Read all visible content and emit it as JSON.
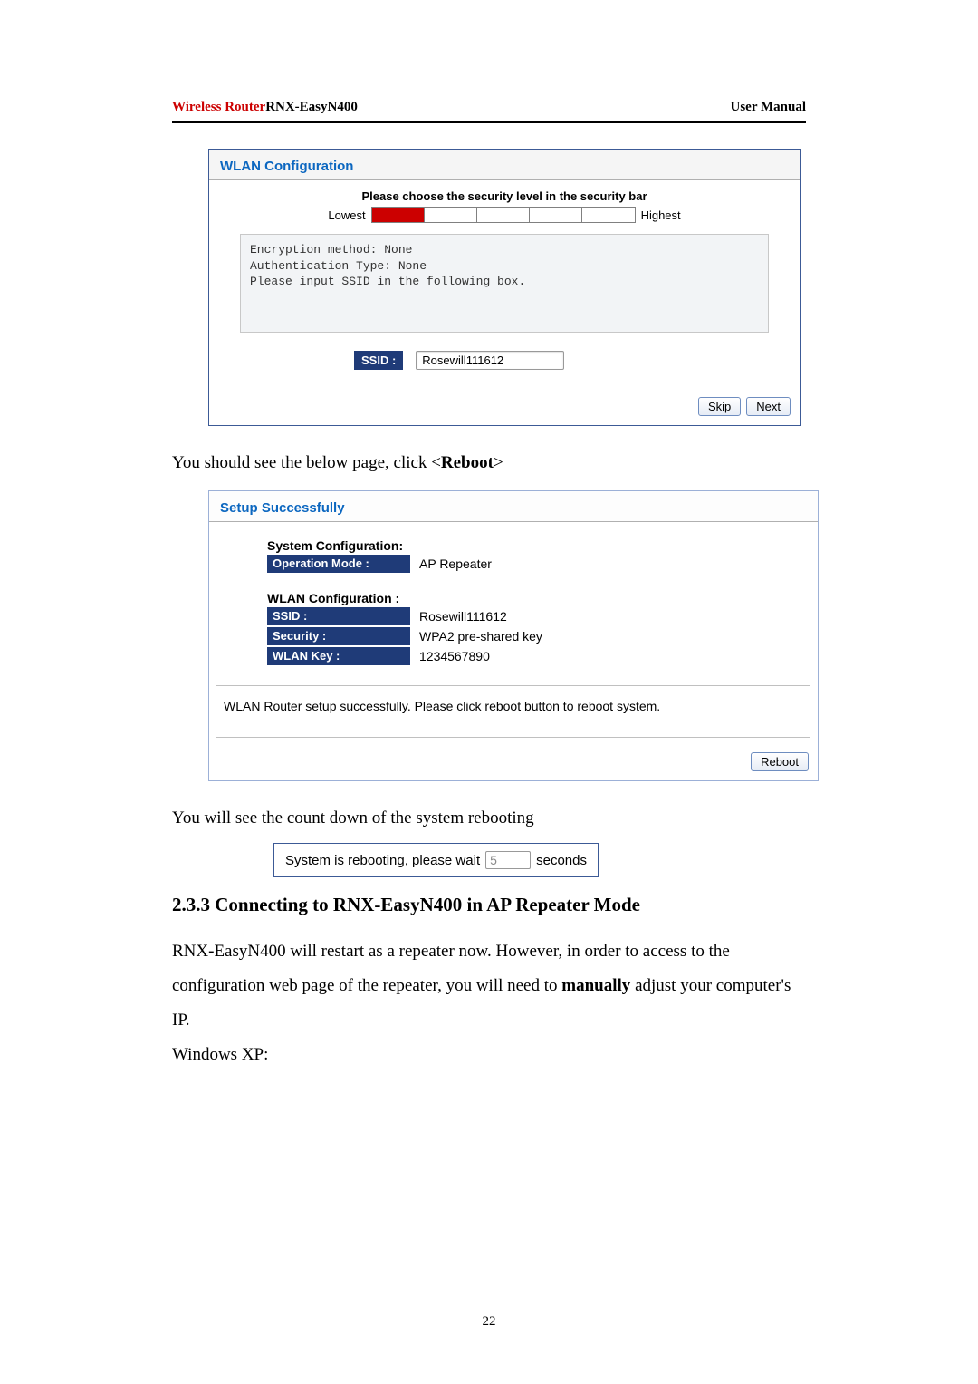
{
  "header": {
    "brand": "Wireless Router",
    "model": "RNX-EasyN400",
    "right": "User Manual"
  },
  "wlan_panel": {
    "title": "WLAN Configuration",
    "instruction": "Please choose the security level in the security bar",
    "lowest_label": "Lowest",
    "highest_label": "Highest",
    "encryption_text": "Encryption method: None\nAuthentication Type: None\nPlease input SSID in the following box.",
    "ssid_label": "SSID :",
    "ssid_value": "Rosewill111612",
    "skip_label": "Skip",
    "next_label": "Next"
  },
  "line1_prefix": "You should see the below page, click <",
  "line1_bold": "Reboot",
  "line1_suffix": ">",
  "setup_panel": {
    "title": "Setup Successfully",
    "sys_hd": "System Configuration:",
    "op_mode_label": "Operation Mode :",
    "op_mode_value": "AP Repeater",
    "wlan_hd": "WLAN Configuration :",
    "ssid_label": "SSID :",
    "ssid_value": "Rosewill111612",
    "security_label": "Security :",
    "security_value": "WPA2 pre-shared key",
    "key_label": "WLAN Key :",
    "key_value": "1234567890",
    "msg": "WLAN Router setup successfully. Please click reboot button to reboot system.",
    "reboot_label": "Reboot"
  },
  "line2": "You will see the count down of the system rebooting",
  "countdown": {
    "prefix": "System is rebooting, please wait",
    "value": "5",
    "suffix": "seconds"
  },
  "section_heading": "2.3.3 Connecting to RNX-EasyN400 in AP Repeater Mode",
  "para_a": "RNX-EasyN400 will restart as a repeater now. However, in order to access to the configuration web page of the repeater, you will need to ",
  "para_bold": "manually",
  "para_b": " adjust your computer's IP.",
  "para_c": "Windows XP:",
  "page_number": "22"
}
